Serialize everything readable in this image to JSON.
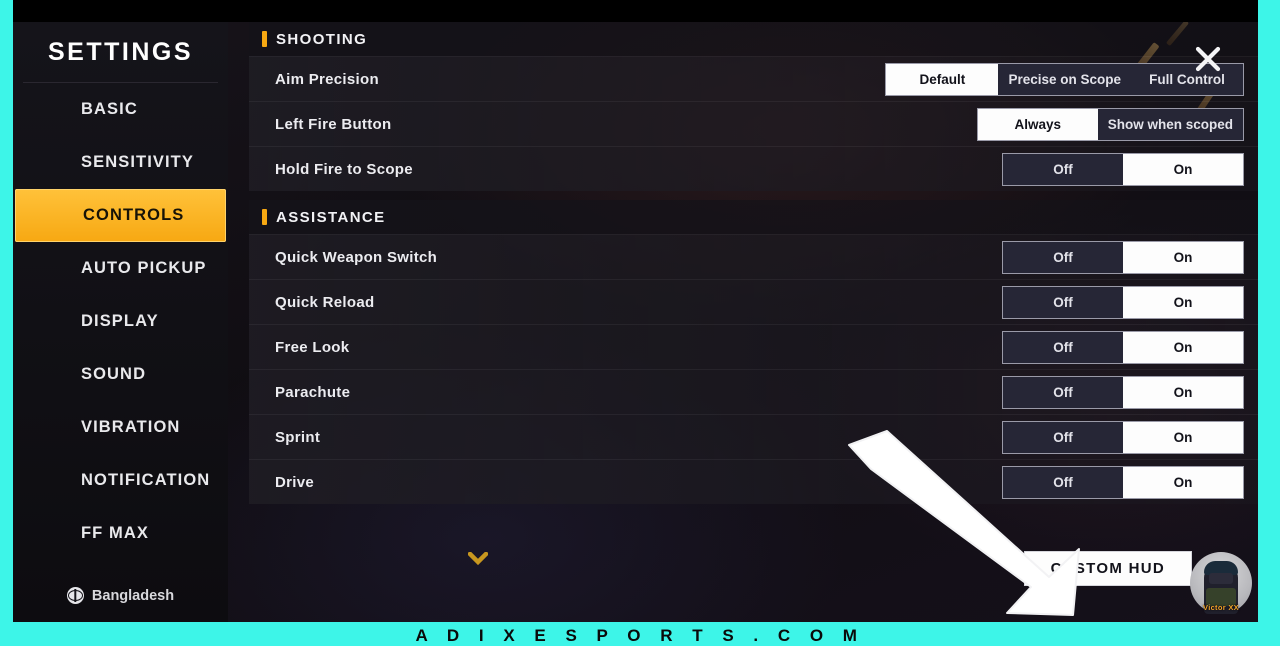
{
  "frame": {
    "accent_color": "#3df5e8",
    "bottom_banner_text": "A D I X E S P O R T S . C O M"
  },
  "sidebar": {
    "title": "SETTINGS",
    "items": [
      {
        "label": "BASIC",
        "active": false
      },
      {
        "label": "SENSITIVITY",
        "active": false
      },
      {
        "label": "CONTROLS",
        "active": true
      },
      {
        "label": "AUTO PICKUP",
        "active": false
      },
      {
        "label": "DISPLAY",
        "active": false
      },
      {
        "label": "SOUND",
        "active": false
      },
      {
        "label": "VIBRATION",
        "active": false
      },
      {
        "label": "NOTIFICATION",
        "active": false
      },
      {
        "label": "FF MAX",
        "active": false
      }
    ],
    "language": "Bangladesh",
    "active_color": "#f7a812"
  },
  "header": {
    "close_label": "✕"
  },
  "sections": [
    {
      "title": "SHOOTING",
      "rows": [
        {
          "label": "Aim Precision",
          "options": [
            "Default",
            "Precise on Scope",
            "Full Control"
          ],
          "selected": "Default",
          "style": "w-aim"
        },
        {
          "label": "Left Fire Button",
          "options": [
            "Always",
            "Show when scoped"
          ],
          "selected": "Always",
          "style": "w-fire"
        },
        {
          "label": "Hold Fire to Scope",
          "options": [
            "Off",
            "On"
          ],
          "selected": "On",
          "style": "w-onoff"
        }
      ]
    },
    {
      "title": "ASSISTANCE",
      "rows": [
        {
          "label": "Quick Weapon Switch",
          "options": [
            "Off",
            "On"
          ],
          "selected": "On",
          "style": "w-onoff"
        },
        {
          "label": "Quick Reload",
          "options": [
            "Off",
            "On"
          ],
          "selected": "On",
          "style": "w-onoff"
        },
        {
          "label": "Free Look",
          "options": [
            "Off",
            "On"
          ],
          "selected": "On",
          "style": "w-onoff"
        },
        {
          "label": "Parachute",
          "options": [
            "Off",
            "On"
          ],
          "selected": "On",
          "style": "w-onoff"
        },
        {
          "label": "Sprint",
          "options": [
            "Off",
            "On"
          ],
          "selected": "On",
          "style": "w-onoff"
        },
        {
          "label": "Drive",
          "options": [
            "Off",
            "On"
          ],
          "selected": "On",
          "style": "w-onoff"
        }
      ]
    }
  ],
  "footer": {
    "custom_hud_label": "CUSTOM HUD"
  },
  "watermark": {
    "tag": "Victor XX"
  }
}
